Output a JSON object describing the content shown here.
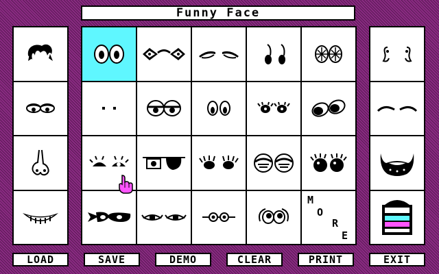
{
  "title": "Funny Face",
  "more_letters": [
    "M",
    "O",
    "R",
    "E"
  ],
  "buttons": {
    "load": "LOAD",
    "save": "SAVE",
    "demo": "DEMO",
    "clear": "CLEAR",
    "print": "PRINT",
    "exit": "EXIT"
  },
  "colors": {
    "background": "#8a2a82",
    "selected": "#5ff7ff",
    "cursor": "#ff55ff"
  },
  "left_parts": [
    "hair",
    "eyes-sleepy",
    "nose",
    "mouth-grin"
  ],
  "right_parts": [
    "ears",
    "eyebrows",
    "beard",
    "hat"
  ],
  "eye_options": [
    "eyes-big-round",
    "sunglasses",
    "eyes-brow-lids",
    "eyes-dangling",
    "eyes-patterned",
    "eyes-dots",
    "eyes-half-closed",
    "eyes-small-oval",
    "eyes-lashes",
    "eyes-black-tilted",
    "eyes-angry-lashes",
    "eye-patch",
    "eyes-spiky-dark",
    "eyes-round-glasses",
    "eyes-dark-lashes",
    "bandit-mask",
    "eyes-narrow-lashes",
    "eyes-tiny-glasses",
    "eyes-googly",
    "more"
  ],
  "selected_option": "eyes-big-round"
}
